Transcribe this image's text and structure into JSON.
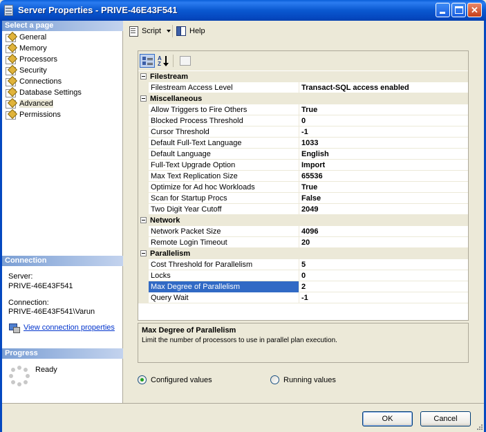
{
  "window": {
    "title": "Server Properties - PRIVE-46E43F541",
    "minimize_label": "",
    "maximize_label": "",
    "close_label": "✕"
  },
  "select_page": {
    "header": "Select a page",
    "items": [
      {
        "label": "General"
      },
      {
        "label": "Memory"
      },
      {
        "label": "Processors"
      },
      {
        "label": "Security"
      },
      {
        "label": "Connections"
      },
      {
        "label": "Database Settings"
      },
      {
        "label": "Advanced"
      },
      {
        "label": "Permissions"
      }
    ],
    "selected": "Advanced"
  },
  "connection": {
    "header": "Connection",
    "server_label": "Server:",
    "server_value": "PRIVE-46E43F541",
    "connection_label": "Connection:",
    "connection_value": "PRIVE-46E43F541\\Varun",
    "view_link": "View connection properties"
  },
  "progress": {
    "header": "Progress",
    "status": "Ready"
  },
  "toolbar": {
    "script_label": "Script",
    "help_label": "Help"
  },
  "property_grid": {
    "alpha_icon_text_top": "A",
    "alpha_icon_text_bottom": "Z",
    "categories": [
      {
        "name": "Filestream",
        "rows": [
          {
            "name": "Filestream Access Level",
            "value": "Transact-SQL access enabled"
          }
        ]
      },
      {
        "name": "Miscellaneous",
        "rows": [
          {
            "name": "Allow Triggers to Fire Others",
            "value": "True"
          },
          {
            "name": "Blocked Process Threshold",
            "value": "0"
          },
          {
            "name": "Cursor Threshold",
            "value": "-1"
          },
          {
            "name": "Default Full-Text Language",
            "value": "1033"
          },
          {
            "name": "Default Language",
            "value": "English"
          },
          {
            "name": "Full-Text Upgrade Option",
            "value": "Import"
          },
          {
            "name": "Max Text Replication Size",
            "value": "65536"
          },
          {
            "name": "Optimize for Ad hoc Workloads",
            "value": "True"
          },
          {
            "name": "Scan for Startup Procs",
            "value": "False"
          },
          {
            "name": "Two Digit Year Cutoff",
            "value": "2049"
          }
        ]
      },
      {
        "name": "Network",
        "rows": [
          {
            "name": "Network Packet Size",
            "value": "4096"
          },
          {
            "name": "Remote Login Timeout",
            "value": "20"
          }
        ]
      },
      {
        "name": "Parallelism",
        "rows": [
          {
            "name": "Cost Threshold for Parallelism",
            "value": "5"
          },
          {
            "name": "Locks",
            "value": "0"
          },
          {
            "name": "Max Degree of Parallelism",
            "value": "2"
          },
          {
            "name": "Query Wait",
            "value": "-1"
          }
        ]
      }
    ],
    "selected_row": "Max Degree of Parallelism",
    "selection_color": "#316ac5"
  },
  "description": {
    "title": "Max Degree of Parallelism",
    "text": "Limit the number of processors to use in parallel plan execution."
  },
  "values_mode": {
    "options": [
      {
        "label": "Configured values",
        "checked": true
      },
      {
        "label": "Running values",
        "checked": false
      }
    ]
  },
  "buttons": {
    "ok": "OK",
    "cancel": "Cancel"
  }
}
